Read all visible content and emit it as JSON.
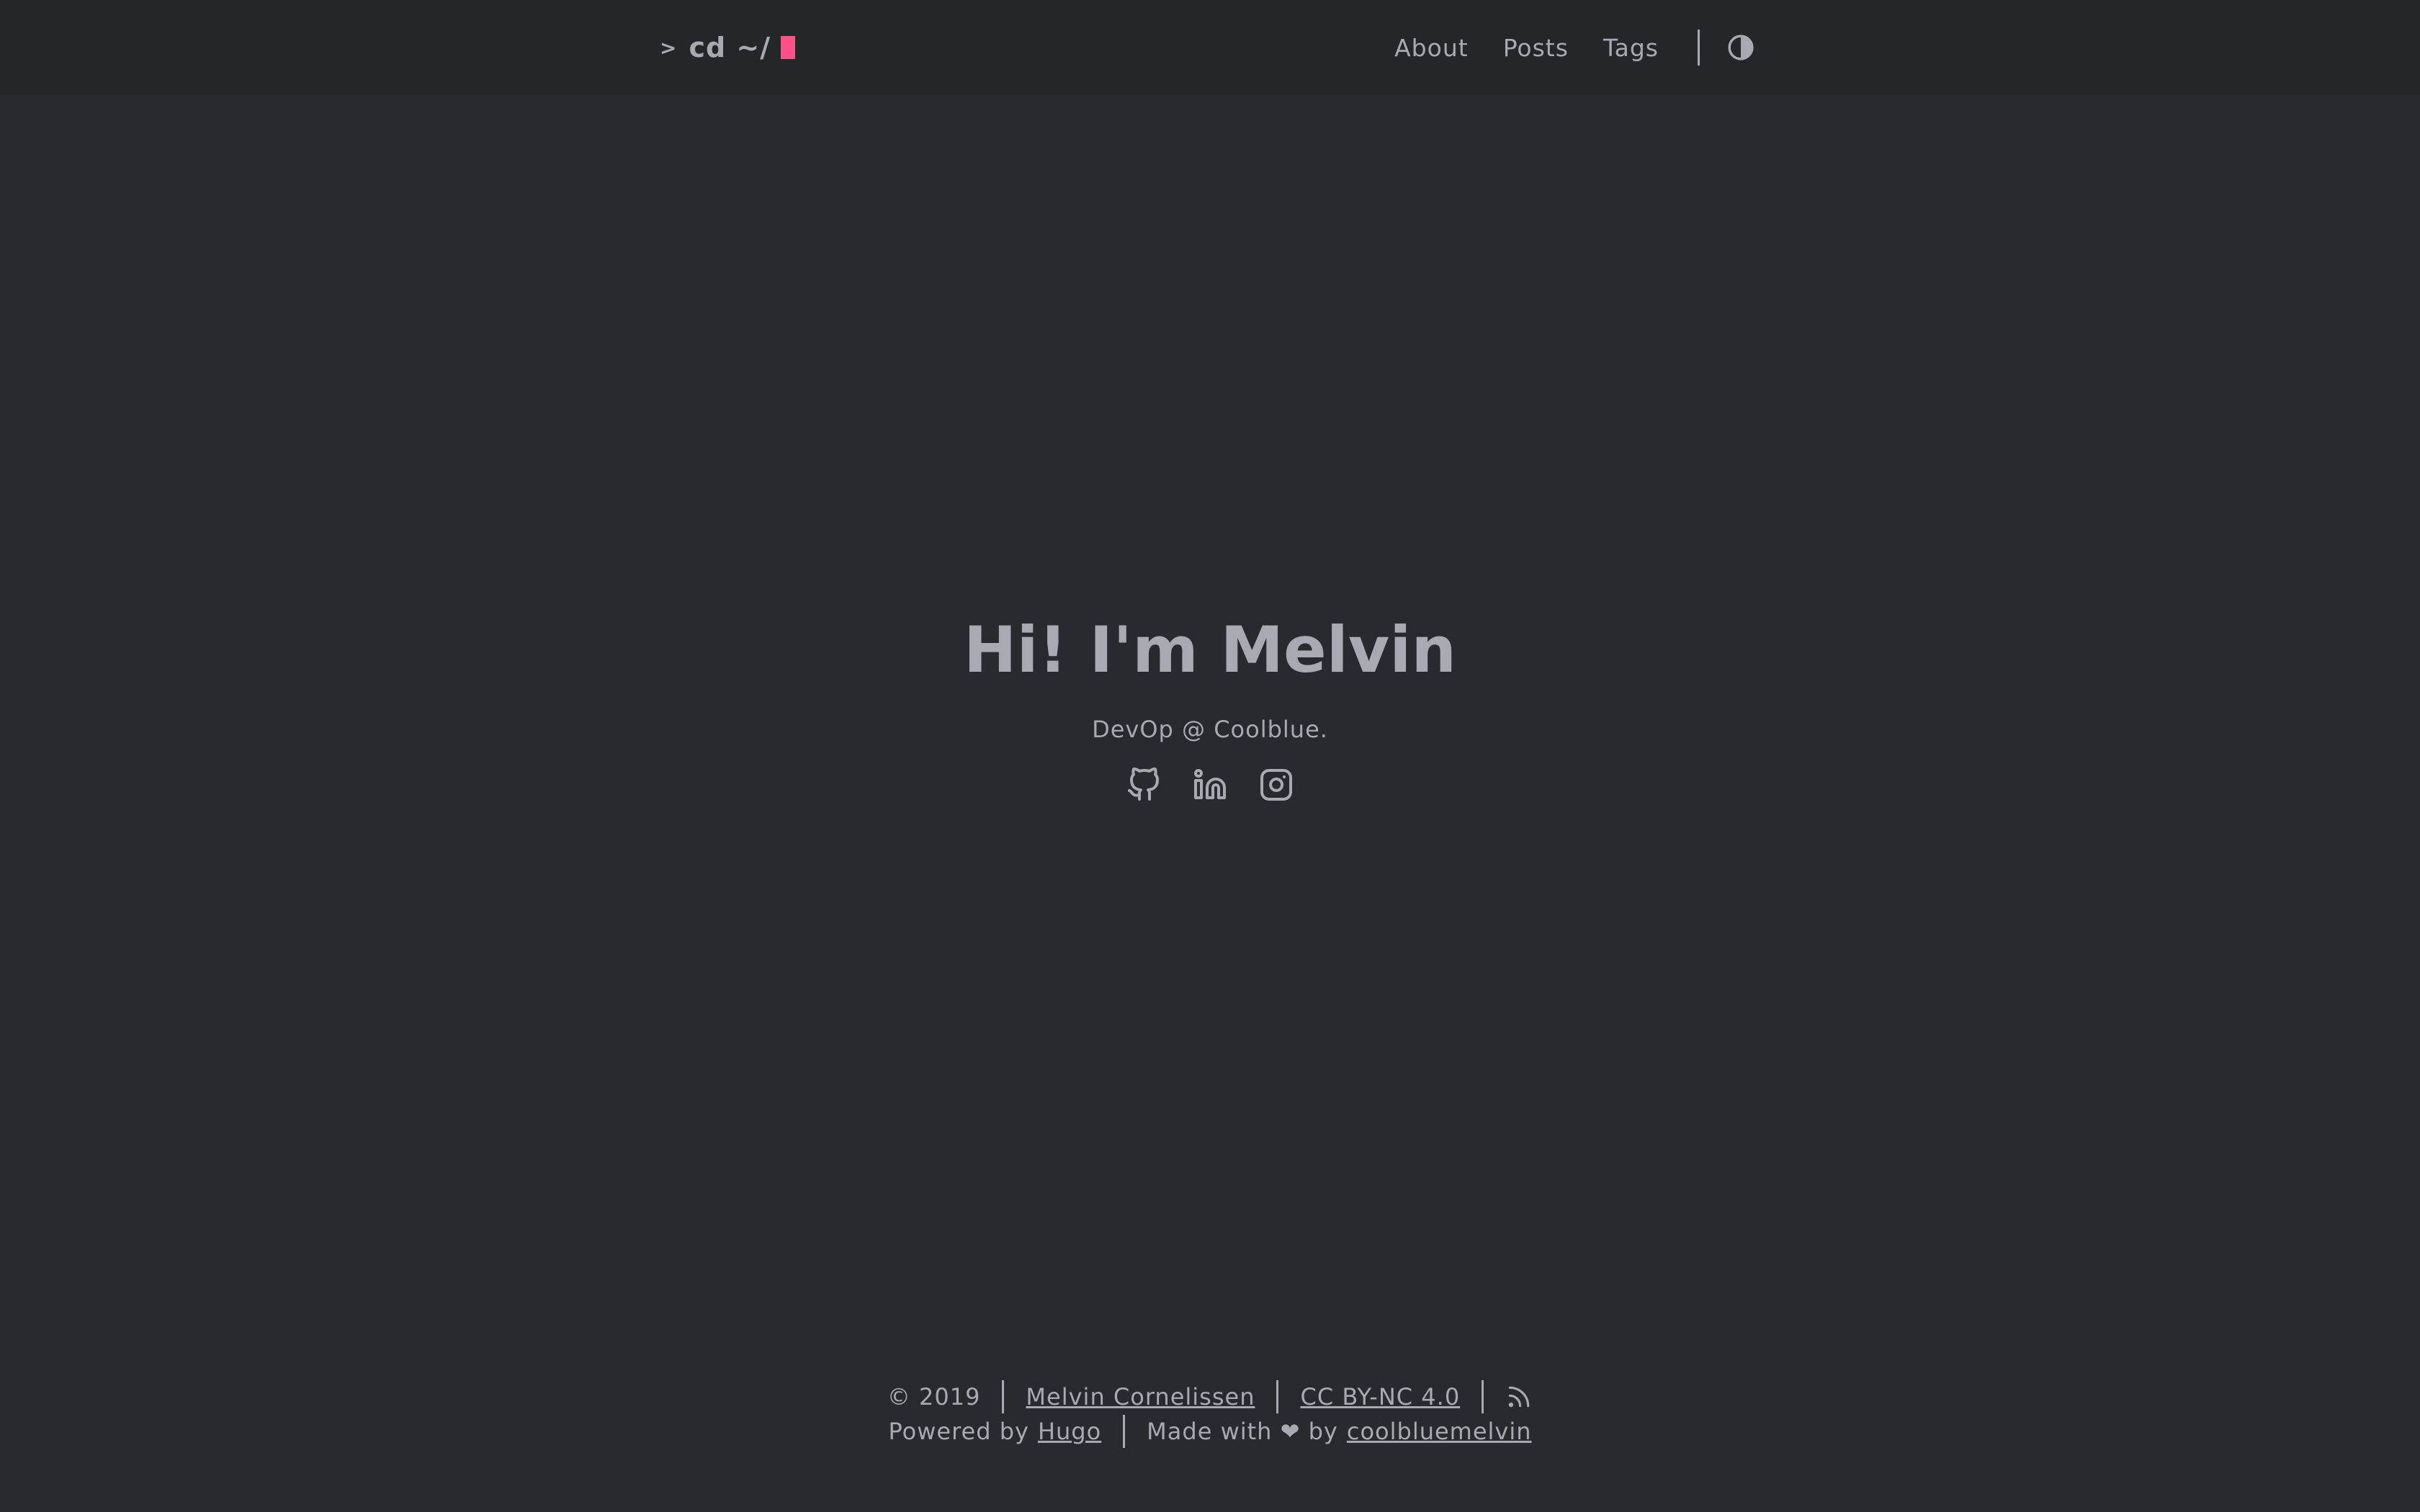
{
  "header": {
    "logo_prompt": ">",
    "logo_text": "cd ~/",
    "nav": [
      {
        "label": "About"
      },
      {
        "label": "Posts"
      },
      {
        "label": "Tags"
      }
    ],
    "theme_toggle_icon": "contrast-icon"
  },
  "hero": {
    "title": "Hi! I'm Melvin",
    "subtitle": "DevOp @ Coolblue.",
    "socials": [
      {
        "icon": "github-icon"
      },
      {
        "icon": "linkedin-icon"
      },
      {
        "icon": "instagram-icon"
      }
    ]
  },
  "footer": {
    "copyright": "© 2019",
    "author_link": "Melvin Cornelissen",
    "license_link": "CC BY-NC 4.0",
    "rss_icon": "rss-icon",
    "powered_prefix": "Powered by",
    "powered_link": "Hugo",
    "made_with": "Made with ❤ by",
    "made_by_link": "coolbluemelvin"
  },
  "colors": {
    "background": "#292a2d",
    "header_background": "#252627",
    "text": "#a9a9b3",
    "cursor_accent": "#fe5186"
  }
}
